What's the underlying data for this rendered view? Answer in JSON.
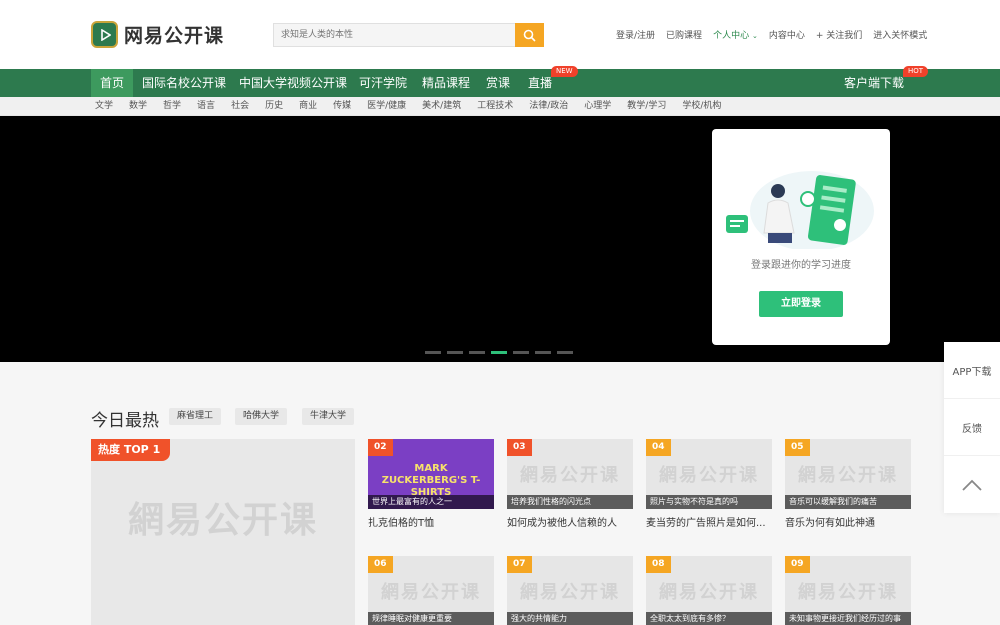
{
  "header": {
    "logo_text": "网易公开课",
    "search_placeholder": "求知是人类的本性",
    "links": [
      "登录/注册",
      "已购课程",
      "个人中心",
      "内容中心",
      "+ 关注我们",
      "进入关怀模式"
    ]
  },
  "nav": {
    "items": [
      "首页",
      "国际名校公开课",
      "中国大学视频公开课",
      "可汗学院",
      "精品课程",
      "赏课",
      "直播"
    ],
    "live_badge": "NEW",
    "download": "客户端下载",
    "download_badge": "HOT"
  },
  "subnav": [
    "文学",
    "数学",
    "哲学",
    "语言",
    "社会",
    "历史",
    "商业",
    "传媒",
    "医学/健康",
    "美术/建筑",
    "工程技术",
    "法律/政治",
    "心理学",
    "教学/学习",
    "学校/机构"
  ],
  "login_card": {
    "tip": "登录跟进你的学习进度",
    "button": "立即登录"
  },
  "side_float": [
    "APP下载",
    "反馈"
  ],
  "hot": {
    "title": "今日最热",
    "tags": [
      "麻省理工",
      "哈佛大学",
      "牛津大学"
    ],
    "top_label": "热度 TOP 1",
    "watermark": "網易公开课",
    "featured_text": "MARK ZUCKERBERG'S T-SHIRTS",
    "cards": [
      {
        "num": "02",
        "caption": "世界上最富有的人之一",
        "title": "扎克伯格的T恤"
      },
      {
        "num": "03",
        "caption": "培养我们性格的闪光点",
        "title": "如何成为被他人信赖的人"
      },
      {
        "num": "04",
        "caption": "照片与实物不符是真的吗",
        "title": "麦当劳的广告照片是如何..."
      },
      {
        "num": "05",
        "caption": "音乐可以缓解我们的痛苦",
        "title": "音乐为何有如此神通"
      },
      {
        "num": "06",
        "caption": "规律睡眠对健康更重要",
        "title": ""
      },
      {
        "num": "07",
        "caption": "强大的共情能力",
        "title": ""
      },
      {
        "num": "08",
        "caption": "全职太太到底有多惨？",
        "title": ""
      },
      {
        "num": "09",
        "caption": "未知事物更接近我们经历过的事",
        "title": ""
      }
    ]
  }
}
